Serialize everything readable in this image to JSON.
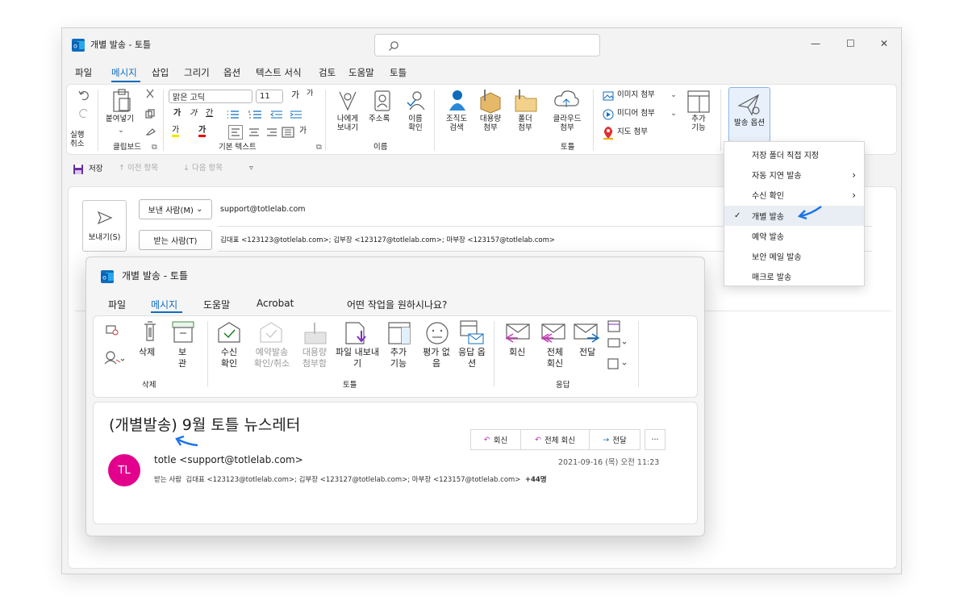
{
  "window": {
    "title": "개별 발송 - 토틀",
    "controls": {
      "minimize": "—",
      "maximize": "☐",
      "close": "✕"
    }
  },
  "menubar": [
    "파일",
    "메시지",
    "삽입",
    "그리기",
    "옵션",
    "텍스트 서식",
    "검토",
    "도움말",
    "토틀"
  ],
  "ribbon": {
    "undo_group": {
      "label": "실행 취소"
    },
    "clipboard": {
      "paste": "붙여넣기",
      "group_label": "클립보드"
    },
    "basic_text": {
      "font": "맑은 고딕",
      "size": "11",
      "group_label": "기본 텍스트",
      "grow": "가",
      "shrink": "가",
      "bold": "가",
      "italic": "가",
      "underline": "간",
      "highlight": "가",
      "fontcolor": "가",
      "style": "가"
    },
    "names": {
      "to_me": "나에게 보내기",
      "address_book": "주소록",
      "check_names": "이름 확인",
      "group_label": "이름"
    },
    "totle": {
      "org_search": "조직도 검색",
      "large_attach": "대용량 첨부",
      "folder_attach": "폴더 첨부",
      "cloud_attach": "클라우드 첨부",
      "group_label": "토틀"
    },
    "attach": {
      "image": "이미지 첨부",
      "media": "미디어 첨부",
      "map": "지도 첨부",
      "add_feature": "추가 기능"
    },
    "send_options": "발송 옵션"
  },
  "qat": {
    "save": "저장",
    "prev": "이전 항목",
    "next": "다음 항목"
  },
  "compose": {
    "send": "보내기(S)",
    "from_label": "보낸 사람(M)",
    "from_value": "support@totlelab.com",
    "to_label": "받는 사람(T)",
    "to_value": "김대표 <123123@totlelab.com>; 김부장 <123127@totlelab.com>; 마부장 <123157@totlelab.com>"
  },
  "dropdown": {
    "items": [
      {
        "label": "저장 폴더 직접 지정",
        "check": "",
        "arrow": ""
      },
      {
        "label": "자동 지연 발송",
        "check": "",
        "arrow": "›"
      },
      {
        "label": "수신 확인",
        "check": "",
        "arrow": "›"
      },
      {
        "label": "개별 발송",
        "check": "✓",
        "arrow": ""
      },
      {
        "label": "예약 발송",
        "check": "",
        "arrow": ""
      },
      {
        "label": "보안 메일 발송",
        "check": "",
        "arrow": ""
      },
      {
        "label": "매크로 발송",
        "check": "",
        "arrow": ""
      }
    ]
  },
  "child": {
    "title": "개별 발송 - 토틀",
    "tabs": [
      "파일",
      "메시지",
      "도움말",
      "Acrobat",
      "어떤 작업을 원하시나요?"
    ],
    "ribbon": {
      "delete": "삭제",
      "archive": "보관",
      "delete_group": "삭제",
      "read_receipt": "수신 확인",
      "schedule_cancel": "예약발송 확인/취소",
      "large_attach": "대용량 첨부함",
      "export_file": "파일 내보내기",
      "add_feature": "추가 기능",
      "no_rating": "평가 없음",
      "reply_options": "응답 옵션",
      "totle_group": "토틀",
      "reply": "회신",
      "reply_all": "전체 회신",
      "forward": "전달",
      "reply_group": "응답"
    },
    "message": {
      "subject": "(개별발송) 9월 토틀 뉴스레터",
      "btn_reply": "회신",
      "btn_reply_all": "전체 회신",
      "btn_forward": "전달",
      "more": "···",
      "avatar": "TL",
      "sender": "totle <support@totlelab.com>",
      "date": "2021-09-16 (목) 오전 11:23",
      "to_label": "받는 사람",
      "to_value": "김대표 <123123@totlelab.com>; 김부장 <123127@totlelab.com>; 마부장 <123157@totlelab.com>",
      "more_count": "+44명"
    }
  },
  "colors": {
    "accent": "#0f6cbd",
    "avatar": "#e3008c",
    "arrow": "#1a73e8"
  }
}
